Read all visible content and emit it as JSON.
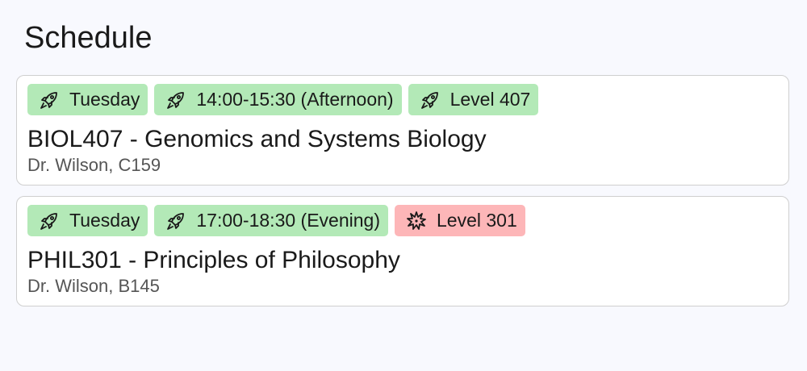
{
  "page": {
    "title": "Schedule"
  },
  "colors": {
    "tag_green": "#b3e9b7",
    "tag_red": "#fdb6b8",
    "background": "#f8f9fe",
    "card_border": "#cfcfcf"
  },
  "courses": [
    {
      "tags": [
        {
          "icon": "rocket-icon",
          "label": "Tuesday",
          "color": "green"
        },
        {
          "icon": "rocket-icon",
          "label": "14:00-15:30 (Afternoon)",
          "color": "green"
        },
        {
          "icon": "rocket-icon",
          "label": "Level 407",
          "color": "green"
        }
      ],
      "title": "BIOL407 - Genomics and Systems Biology",
      "subtitle": "Dr. Wilson, C159"
    },
    {
      "tags": [
        {
          "icon": "rocket-icon",
          "label": "Tuesday",
          "color": "green"
        },
        {
          "icon": "rocket-icon",
          "label": "17:00-18:30 (Evening)",
          "color": "green"
        },
        {
          "icon": "explosion-icon",
          "label": "Level 301",
          "color": "red"
        }
      ],
      "title": "PHIL301 - Principles of Philosophy",
      "subtitle": "Dr. Wilson, B145"
    }
  ]
}
